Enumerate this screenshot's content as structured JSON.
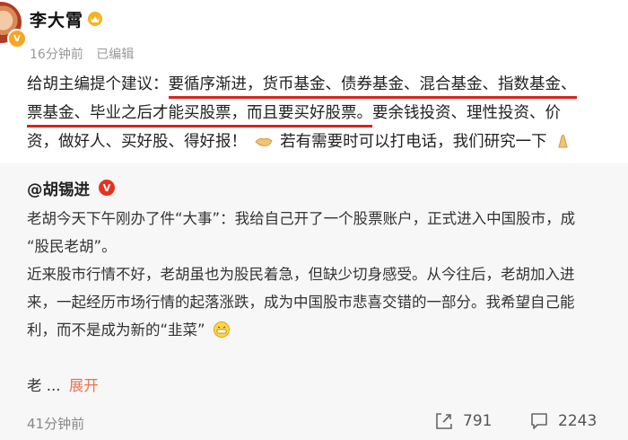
{
  "post": {
    "author": "李大霄",
    "time": "16分钟前",
    "edited": "已编辑",
    "lines": [
      {
        "pre": "给胡主编提个建议：",
        "hl": "要循序渐进，货币基金、债券基金、混合基金、指数基金、",
        "post": ""
      },
      {
        "pre": "",
        "hl": "票基金、毕业之后才能买股票，而且要买好股票。",
        "post": "要余钱投资、理性投资、价"
      },
      {
        "pre": "资，做好人、买好股、得好报！",
        "mid": "若有需要时可以打电话，我们研究一下",
        "post": ""
      }
    ]
  },
  "quote": {
    "author": "@胡锡进",
    "lines": [
      "老胡今天下午刚办了件“大事”：我给自己开了一个股票账户，正式进入中国股市，成",
      "“股民老胡”。",
      "近来股市行情不好，老胡虽也为股民着急，但缺少切身感受。从今往后，老胡加入进",
      "来，一起经历市场行情的起落涨跌，成为中国股市悲喜交错的一部分。我希望自己能",
      "利，而不是成为新的“韭菜”"
    ],
    "truncated": "老",
    "ellipsis": "...",
    "expand": "展开",
    "time": "41分钟前",
    "reposts": "791",
    "comments": "2243"
  },
  "colors": {
    "highlight_underline": "#d9231d",
    "expand_link": "#eb7350",
    "verified": "#e6321e",
    "card_bg": "#f7f7f7"
  },
  "icons": [
    "avatar",
    "crown-icon",
    "verified-icon",
    "handshake-emoji-icon",
    "clasped-hands-emoji-icon",
    "grin-emoji-icon",
    "repost-icon",
    "comment-icon"
  ]
}
